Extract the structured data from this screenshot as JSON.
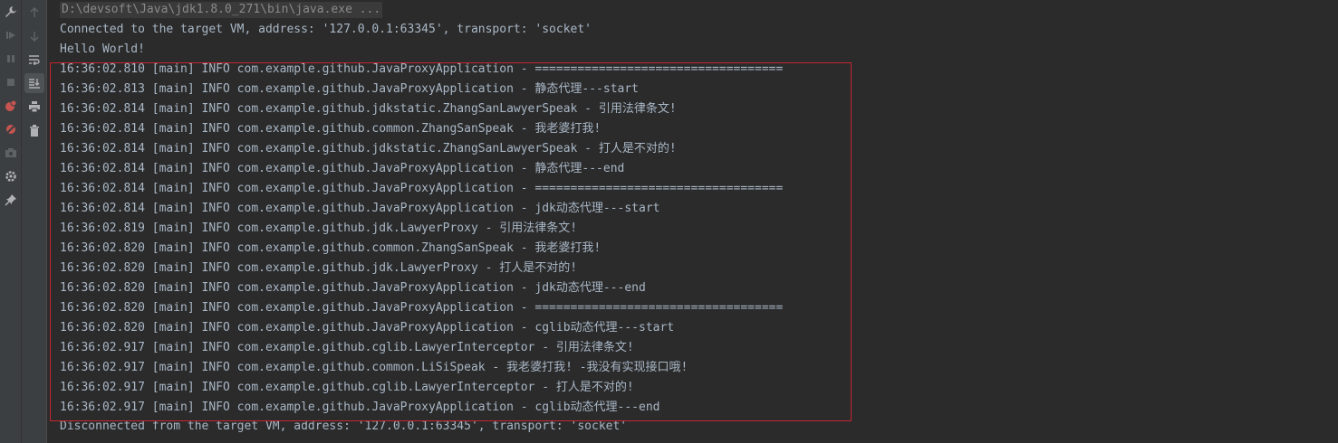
{
  "command_line": "D:\\devsoft\\Java\\jdk1.8.0_271\\bin\\java.exe ...",
  "connected_line": "Connected to the target VM, address: '127.0.0.1:63345', transport: 'socket'",
  "hello_line": "Hello World!",
  "log_lines": [
    "16:36:02.810 [main] INFO com.example.github.JavaProxyApplication - ===================================",
    "16:36:02.813 [main] INFO com.example.github.JavaProxyApplication - 静态代理---start",
    "16:36:02.814 [main] INFO com.example.github.jdkstatic.ZhangSanLawyerSpeak - 引用法律条文!",
    "16:36:02.814 [main] INFO com.example.github.common.ZhangSanSpeak - 我老婆打我!",
    "16:36:02.814 [main] INFO com.example.github.jdkstatic.ZhangSanLawyerSpeak - 打人是不对的!",
    "16:36:02.814 [main] INFO com.example.github.JavaProxyApplication - 静态代理---end",
    "16:36:02.814 [main] INFO com.example.github.JavaProxyApplication - ===================================",
    "16:36:02.814 [main] INFO com.example.github.JavaProxyApplication - jdk动态代理---start",
    "16:36:02.819 [main] INFO com.example.github.jdk.LawyerProxy - 引用法律条文!",
    "16:36:02.820 [main] INFO com.example.github.common.ZhangSanSpeak - 我老婆打我!",
    "16:36:02.820 [main] INFO com.example.github.jdk.LawyerProxy - 打人是不对的!",
    "16:36:02.820 [main] INFO com.example.github.JavaProxyApplication - jdk动态代理---end",
    "16:36:02.820 [main] INFO com.example.github.JavaProxyApplication - ===================================",
    "16:36:02.820 [main] INFO com.example.github.JavaProxyApplication - cglib动态代理---start",
    "16:36:02.917 [main] INFO com.example.github.cglib.LawyerInterceptor - 引用法律条文!",
    "16:36:02.917 [main] INFO com.example.github.common.LiSiSpeak - 我老婆打我! -我没有实现接口哦!",
    "16:36:02.917 [main] INFO com.example.github.cglib.LawyerInterceptor - 打人是不对的!",
    "16:36:02.917 [main] INFO com.example.github.JavaProxyApplication - cglib动态代理---end"
  ],
  "disconnected_line": "Disconnected from the target VM, address: '127.0.0.1:63345', transport: 'socket'",
  "icons": {
    "far_left": [
      "wrench-icon",
      "rerun-icon",
      "pause-icon",
      "stop-icon",
      "view-breakpoints-icon",
      "mute-breakpoints-icon",
      "camera-icon",
      "settings-icon",
      "pin-icon"
    ],
    "toolbar": [
      "arrow-up-icon",
      "arrow-down-icon",
      "soft-wrap-icon",
      "scroll-to-end-icon",
      "print-icon",
      "trash-icon"
    ]
  },
  "colors": {
    "background": "#2b2b2b",
    "text": "#a9b7c6",
    "highlight_border": "#c4262e"
  }
}
